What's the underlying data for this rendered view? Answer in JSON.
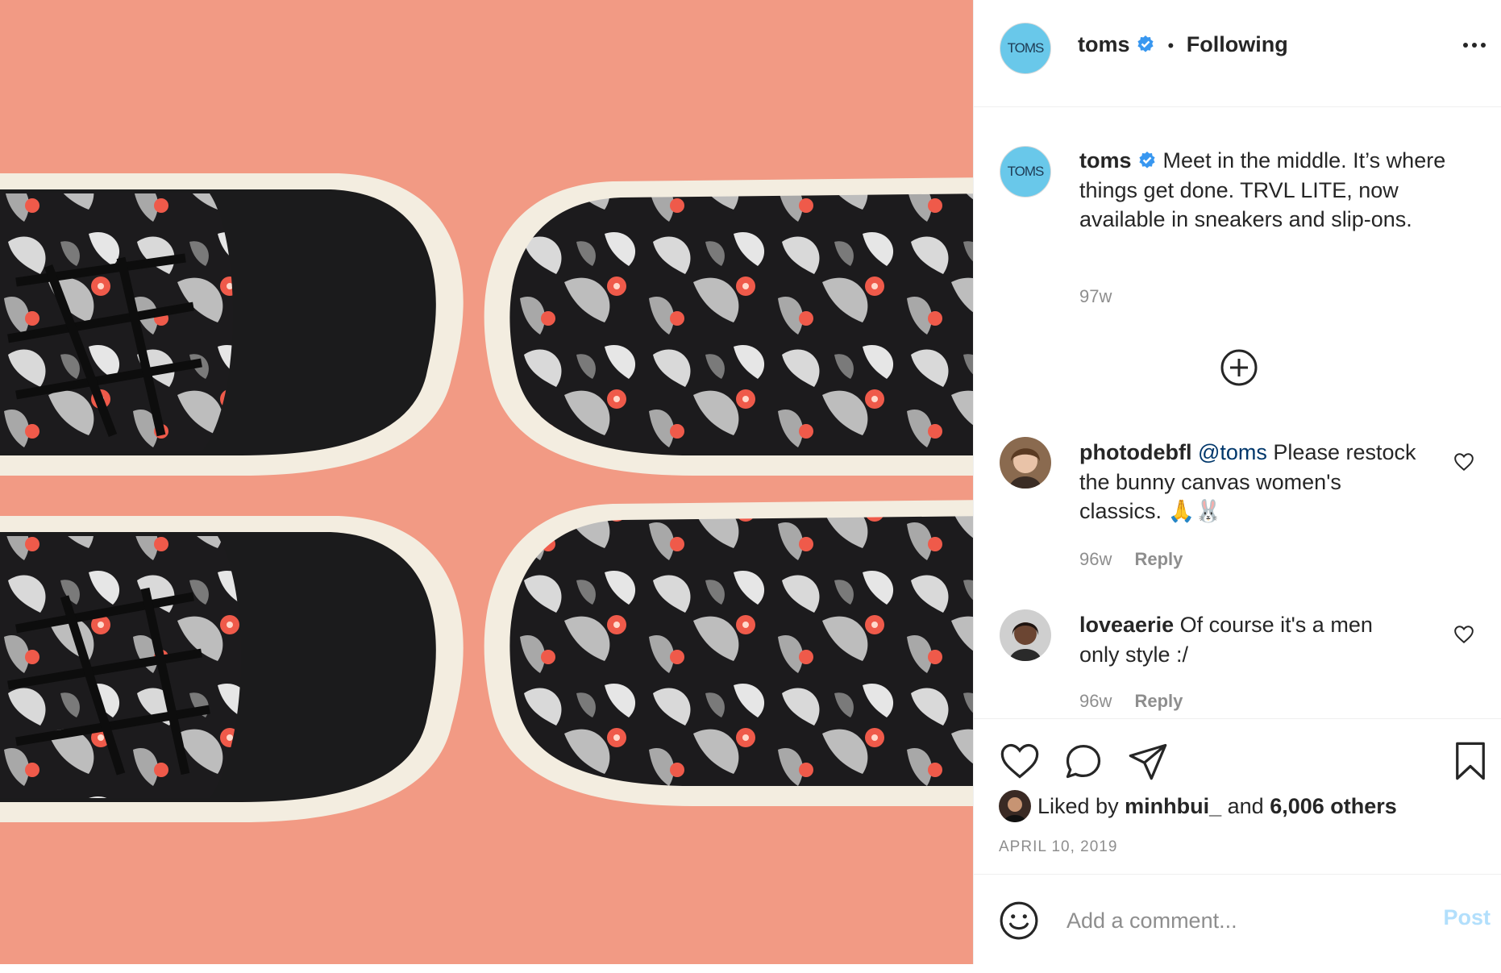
{
  "header": {
    "avatar_text": "TOMS",
    "username": "toms",
    "separator": "•",
    "follow_status": "Following"
  },
  "caption": {
    "avatar_text": "TOMS",
    "username": "toms",
    "text": "Meet in the middle. It’s where things get done. TRVL LITE, now available in sneakers and slip-ons.",
    "age": "97w"
  },
  "comments": [
    {
      "username": "photodebfl",
      "mention": "@toms",
      "text": "Please restock the bunny canvas women's classics. 🙏🐰",
      "age": "96w",
      "reply_label": "Reply"
    },
    {
      "username": "loveaerie",
      "mention": "",
      "text": "Of course it's a men only style :/",
      "age": "96w",
      "reply_label": "Reply"
    }
  ],
  "likes": {
    "prefix": "Liked by",
    "user": "minhbui_",
    "conjunction": "and",
    "others": "6,006 others"
  },
  "date": "APRIL 10, 2019",
  "add_comment": {
    "placeholder": "Add a comment...",
    "post_label": "Post"
  },
  "icons": {
    "more": "more-options-icon",
    "verified": "verified-badge-icon",
    "load_more": "plus-circle-icon",
    "like": "heart-icon",
    "comment": "comment-bubble-icon",
    "share": "paper-plane-icon",
    "save": "bookmark-icon",
    "emoji": "smiley-icon"
  },
  "colors": {
    "photo_background": "#f29a84",
    "verified": "#3897f0",
    "link": "#00376b",
    "muted": "#8e8e8e",
    "post_disabled": "#b2dffc",
    "avatar_toms": "#69c8ea"
  }
}
